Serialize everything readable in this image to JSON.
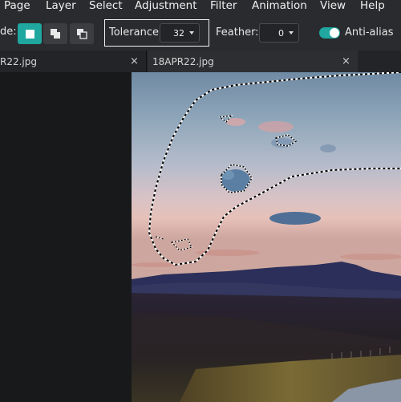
{
  "menu": {
    "items": [
      "Page",
      "Layer",
      "Select",
      "Adjustment",
      "Filter",
      "Animation",
      "View",
      "Help"
    ]
  },
  "toolbar": {
    "mode_label": "de:",
    "mode_icons": [
      "new-selection-icon",
      "add-selection-icon",
      "subtract-selection-icon"
    ],
    "tolerance_label": "Tolerance:",
    "tolerance_value": "32",
    "feather_label": "Feather:",
    "feather_value": "0",
    "antialias_label": "Anti-alias",
    "antialias_on": true
  },
  "tabs": [
    {
      "label": "R22.jpg",
      "close": "×"
    },
    {
      "label": "18APR22.jpg",
      "close": "×"
    }
  ],
  "colors": {
    "accent": "#1fa7a0",
    "panel": "#2a2b2e",
    "background": "#1b1c1e"
  }
}
